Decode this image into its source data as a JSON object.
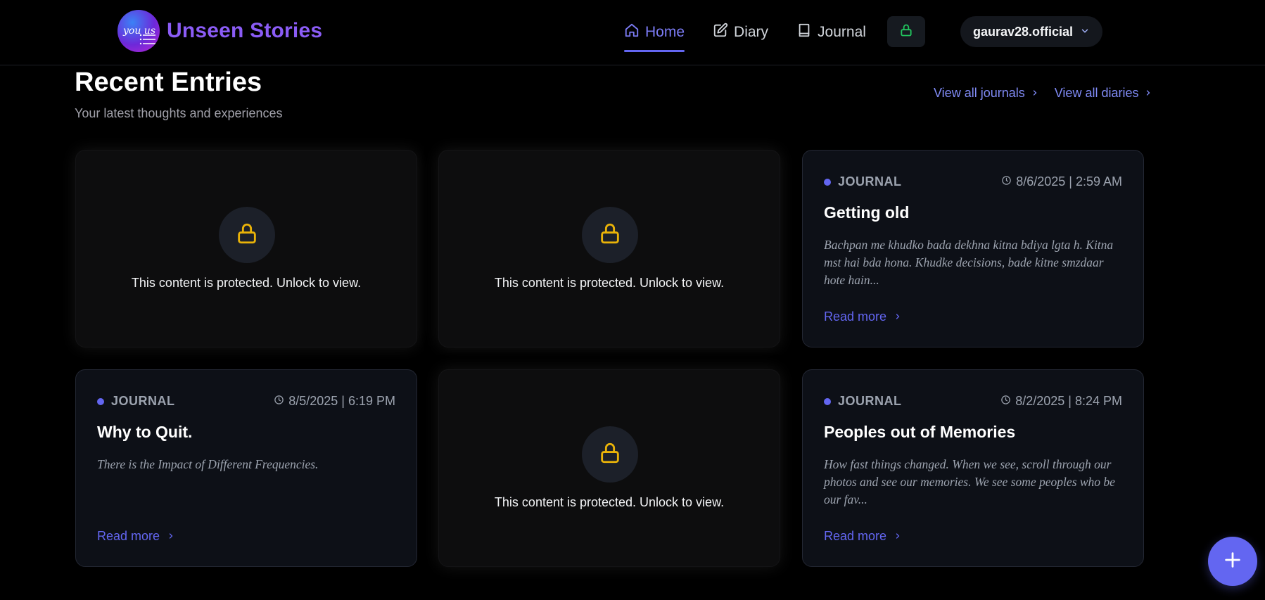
{
  "brand": {
    "name": "Unseen Stories",
    "logo_text": "you us"
  },
  "nav": {
    "home": "Home",
    "diary": "Diary",
    "journal": "Journal"
  },
  "user": {
    "name": "gaurav28.official"
  },
  "section": {
    "title": "Recent Entries",
    "subtitle": "Your latest thoughts and experiences",
    "view_journals": "View all journals",
    "view_diaries": "View all diaries"
  },
  "locked_message": "This content is protected. Unlock to view.",
  "entries": [
    {
      "tag": "JOURNAL",
      "date": "8/6/2025 | 2:59 AM",
      "title": "Getting old",
      "excerpt": "Bachpan me khudko bada dekhna kitna bdiya lgta h. Kitna mst hai bda hona. Khudke decisions, bade kitne smzdaar hote hain...",
      "read_more": "Read more"
    },
    {
      "tag": "JOURNAL",
      "date": "8/5/2025 | 6:19 PM",
      "title": "Why to Quit.",
      "excerpt": "There is the Impact of Different Frequencies.",
      "read_more": "Read more"
    },
    {
      "tag": "JOURNAL",
      "date": "8/2/2025 | 8:24 PM",
      "title": "Peoples out of Memories",
      "excerpt": "How fast things changed. When we see, scroll through our photos and see our memories. We see some peoples who be our fav...",
      "read_more": "Read more"
    }
  ],
  "colors": {
    "accent": "#6366f1",
    "brand": "#8b5cf6",
    "lock_yellow": "#eab308",
    "lock_green": "#22c55e"
  }
}
